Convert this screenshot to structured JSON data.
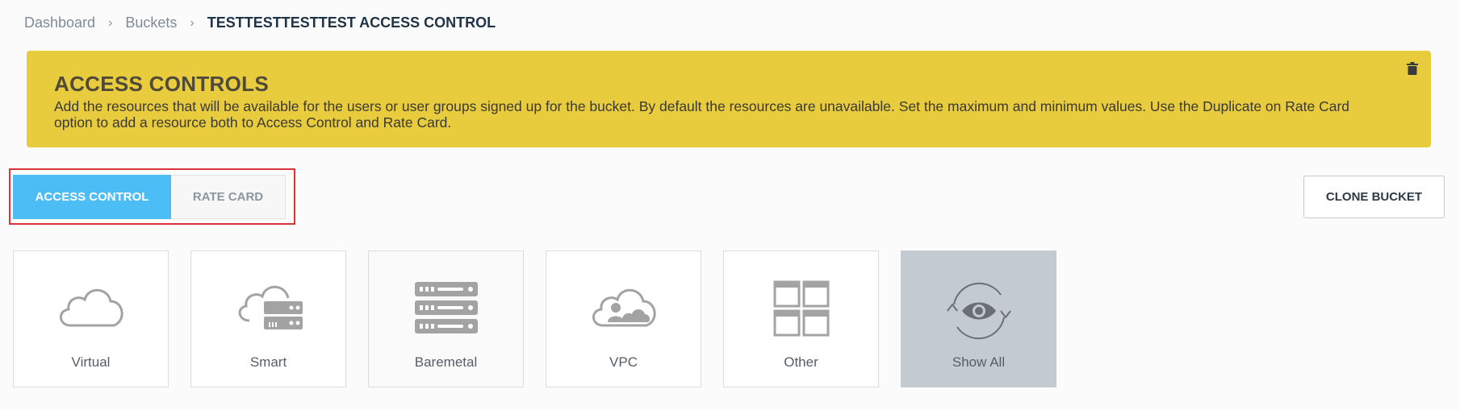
{
  "breadcrumb": {
    "items": [
      "Dashboard",
      "Buckets"
    ],
    "current": "TESTTESTTESTTEST ACCESS CONTROL",
    "separator": "›"
  },
  "banner": {
    "title": "ACCESS CONTROLS",
    "description": "Add the resources that will be available for the users or user groups signed up for the bucket. By default the resources are unavailable. Set the maximum and minimum values. Use the Duplicate on Rate Card option to add a resource both to Access Control and Rate Card.",
    "color": "#e9cb3e"
  },
  "tabs": [
    {
      "label": "ACCESS CONTROL",
      "active": true
    },
    {
      "label": "RATE CARD",
      "active": false
    }
  ],
  "actions": {
    "clone_label": "CLONE BUCKET"
  },
  "resources": [
    {
      "label": "Virtual",
      "icon": "cloud-icon"
    },
    {
      "label": "Smart",
      "icon": "cloud-server-icon"
    },
    {
      "label": "Baremetal",
      "icon": "server-rack-icon"
    },
    {
      "label": "VPC",
      "icon": "cloud-users-icon"
    },
    {
      "label": "Other",
      "icon": "grid-icon"
    },
    {
      "label": "Show All",
      "icon": "eye-refresh-icon",
      "selected": true
    }
  ],
  "colors": {
    "accent": "#4cbdf5",
    "highlight": "#d9333c",
    "selected_card": "#c3cad1"
  }
}
